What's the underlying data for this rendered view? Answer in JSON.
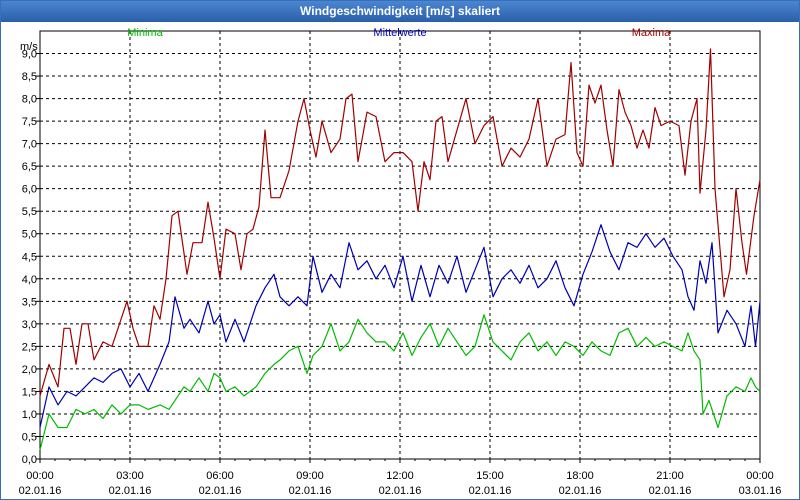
{
  "window": {
    "title": "Windgeschwindigkeit [m/s] skaliert"
  },
  "colors": {
    "title_bar": "#2f66b3",
    "grid": "#000000",
    "minima": "#00bb00",
    "mittel": "#0000b0",
    "maxima": "#a00000"
  },
  "chart_data": {
    "type": "line",
    "title": "Windgeschwindigkeit [m/s] skaliert",
    "ylabel": "m/s",
    "xlabel": "",
    "ylim": [
      0,
      9.5
    ],
    "y_ticks": [
      "0,0",
      "0,5",
      "1,0",
      "1,5",
      "2,0",
      "2,5",
      "3,0",
      "3,5",
      "4,0",
      "4,5",
      "5,0",
      "5,5",
      "6,0",
      "6,5",
      "7,0",
      "7,5",
      "8,0",
      "8,5",
      "9,0"
    ],
    "x_ticks": [
      {
        "time": "00:00",
        "date": "02.01.16"
      },
      {
        "time": "03:00",
        "date": "02.01.16"
      },
      {
        "time": "06:00",
        "date": "02.01.16"
      },
      {
        "time": "09:00",
        "date": "02.01.16"
      },
      {
        "time": "12:00",
        "date": "02.01.16"
      },
      {
        "time": "15:00",
        "date": "02.01.16"
      },
      {
        "time": "18:00",
        "date": "02.01.16"
      },
      {
        "time": "21:00",
        "date": "02.01.16"
      },
      {
        "time": "00:00",
        "date": "03.01.16"
      }
    ],
    "x_range_hours": [
      0,
      24
    ],
    "grid": true,
    "legend_position": "top",
    "series": [
      {
        "name": "Minima",
        "points": [
          [
            0,
            0.2
          ],
          [
            0.3,
            1.0
          ],
          [
            0.6,
            0.7
          ],
          [
            0.9,
            0.7
          ],
          [
            1.2,
            1.1
          ],
          [
            1.5,
            1.0
          ],
          [
            1.8,
            1.1
          ],
          [
            2.1,
            0.9
          ],
          [
            2.4,
            1.2
          ],
          [
            2.7,
            1.0
          ],
          [
            3.0,
            1.2
          ],
          [
            3.3,
            1.2
          ],
          [
            3.6,
            1.1
          ],
          [
            4.0,
            1.2
          ],
          [
            4.3,
            1.1
          ],
          [
            4.5,
            1.3
          ],
          [
            4.8,
            1.6
          ],
          [
            5.0,
            1.5
          ],
          [
            5.3,
            1.8
          ],
          [
            5.6,
            1.5
          ],
          [
            5.8,
            1.9
          ],
          [
            6.0,
            1.8
          ],
          [
            6.2,
            1.5
          ],
          [
            6.5,
            1.6
          ],
          [
            6.8,
            1.4
          ],
          [
            7.0,
            1.5
          ],
          [
            7.2,
            1.6
          ],
          [
            7.5,
            1.9
          ],
          [
            7.8,
            2.1
          ],
          [
            8.0,
            2.2
          ],
          [
            8.3,
            2.4
          ],
          [
            8.6,
            2.5
          ],
          [
            8.9,
            1.9
          ],
          [
            9.1,
            2.3
          ],
          [
            9.4,
            2.5
          ],
          [
            9.7,
            3.0
          ],
          [
            10.0,
            2.4
          ],
          [
            10.3,
            2.6
          ],
          [
            10.6,
            3.1
          ],
          [
            10.9,
            2.8
          ],
          [
            11.2,
            2.6
          ],
          [
            11.5,
            2.6
          ],
          [
            11.8,
            2.4
          ],
          [
            12.1,
            2.8
          ],
          [
            12.4,
            2.3
          ],
          [
            12.7,
            2.7
          ],
          [
            13.0,
            3.0
          ],
          [
            13.3,
            2.5
          ],
          [
            13.6,
            2.9
          ],
          [
            13.9,
            2.6
          ],
          [
            14.2,
            2.3
          ],
          [
            14.5,
            2.5
          ],
          [
            14.8,
            3.2
          ],
          [
            15.1,
            2.6
          ],
          [
            15.4,
            2.4
          ],
          [
            15.7,
            2.2
          ],
          [
            16.0,
            2.6
          ],
          [
            16.3,
            2.8
          ],
          [
            16.6,
            2.4
          ],
          [
            16.9,
            2.6
          ],
          [
            17.2,
            2.3
          ],
          [
            17.5,
            2.6
          ],
          [
            17.8,
            2.5
          ],
          [
            18.1,
            2.3
          ],
          [
            18.4,
            2.6
          ],
          [
            18.7,
            2.4
          ],
          [
            19.0,
            2.3
          ],
          [
            19.3,
            2.8
          ],
          [
            19.6,
            2.9
          ],
          [
            19.9,
            2.5
          ],
          [
            20.2,
            2.7
          ],
          [
            20.5,
            2.5
          ],
          [
            20.8,
            2.6
          ],
          [
            21.1,
            2.5
          ],
          [
            21.4,
            2.4
          ],
          [
            21.6,
            2.8
          ],
          [
            21.8,
            2.4
          ],
          [
            22.0,
            2.2
          ],
          [
            22.1,
            1.0
          ],
          [
            22.3,
            1.3
          ],
          [
            22.6,
            0.7
          ],
          [
            22.9,
            1.4
          ],
          [
            23.2,
            1.6
          ],
          [
            23.5,
            1.5
          ],
          [
            23.7,
            1.8
          ],
          [
            23.85,
            1.6
          ],
          [
            24.0,
            1.5
          ]
        ]
      },
      {
        "name": "Mittelwerte",
        "points": [
          [
            0,
            0.7
          ],
          [
            0.3,
            1.6
          ],
          [
            0.6,
            1.2
          ],
          [
            0.9,
            1.5
          ],
          [
            1.2,
            1.4
          ],
          [
            1.5,
            1.6
          ],
          [
            1.8,
            1.8
          ],
          [
            2.1,
            1.7
          ],
          [
            2.4,
            1.9
          ],
          [
            2.7,
            2.0
          ],
          [
            3.0,
            1.6
          ],
          [
            3.3,
            1.9
          ],
          [
            3.6,
            1.5
          ],
          [
            4.0,
            2.1
          ],
          [
            4.3,
            2.6
          ],
          [
            4.5,
            3.6
          ],
          [
            4.8,
            2.9
          ],
          [
            5.0,
            3.1
          ],
          [
            5.3,
            2.8
          ],
          [
            5.6,
            3.5
          ],
          [
            5.8,
            3.0
          ],
          [
            6.0,
            3.2
          ],
          [
            6.2,
            2.6
          ],
          [
            6.5,
            3.1
          ],
          [
            6.8,
            2.6
          ],
          [
            7.0,
            3.0
          ],
          [
            7.2,
            3.4
          ],
          [
            7.5,
            3.8
          ],
          [
            7.8,
            4.1
          ],
          [
            8.0,
            3.6
          ],
          [
            8.3,
            3.4
          ],
          [
            8.6,
            3.6
          ],
          [
            8.9,
            3.4
          ],
          [
            9.1,
            4.5
          ],
          [
            9.4,
            3.7
          ],
          [
            9.7,
            4.1
          ],
          [
            10.0,
            3.8
          ],
          [
            10.3,
            4.8
          ],
          [
            10.6,
            4.2
          ],
          [
            10.9,
            4.4
          ],
          [
            11.2,
            4.0
          ],
          [
            11.5,
            4.3
          ],
          [
            11.8,
            3.8
          ],
          [
            12.1,
            4.5
          ],
          [
            12.4,
            3.5
          ],
          [
            12.7,
            4.3
          ],
          [
            13.0,
            3.6
          ],
          [
            13.3,
            4.3
          ],
          [
            13.6,
            3.9
          ],
          [
            13.9,
            4.5
          ],
          [
            14.2,
            3.7
          ],
          [
            14.5,
            4.2
          ],
          [
            14.8,
            4.7
          ],
          [
            15.1,
            3.6
          ],
          [
            15.4,
            4.0
          ],
          [
            15.7,
            4.2
          ],
          [
            16.0,
            3.9
          ],
          [
            16.3,
            4.3
          ],
          [
            16.6,
            3.8
          ],
          [
            16.9,
            4.0
          ],
          [
            17.2,
            4.4
          ],
          [
            17.5,
            3.8
          ],
          [
            17.8,
            3.4
          ],
          [
            18.1,
            4.1
          ],
          [
            18.4,
            4.6
          ],
          [
            18.7,
            5.2
          ],
          [
            19.0,
            4.6
          ],
          [
            19.3,
            4.2
          ],
          [
            19.6,
            4.8
          ],
          [
            19.9,
            4.7
          ],
          [
            20.2,
            5.0
          ],
          [
            20.5,
            4.7
          ],
          [
            20.8,
            4.9
          ],
          [
            21.1,
            4.5
          ],
          [
            21.4,
            4.2
          ],
          [
            21.6,
            3.6
          ],
          [
            21.8,
            3.3
          ],
          [
            22.0,
            4.4
          ],
          [
            22.2,
            3.9
          ],
          [
            22.4,
            4.8
          ],
          [
            22.6,
            2.8
          ],
          [
            22.9,
            3.3
          ],
          [
            23.2,
            3.0
          ],
          [
            23.5,
            2.5
          ],
          [
            23.7,
            3.4
          ],
          [
            23.85,
            2.5
          ],
          [
            24.0,
            3.5
          ]
        ]
      },
      {
        "name": "Maxima",
        "points": [
          [
            0,
            1.4
          ],
          [
            0.3,
            2.1
          ],
          [
            0.6,
            1.6
          ],
          [
            0.8,
            2.9
          ],
          [
            1.0,
            2.9
          ],
          [
            1.2,
            2.1
          ],
          [
            1.4,
            3.0
          ],
          [
            1.6,
            3.0
          ],
          [
            1.8,
            2.2
          ],
          [
            2.1,
            2.6
          ],
          [
            2.4,
            2.5
          ],
          [
            2.7,
            3.1
          ],
          [
            2.9,
            3.5
          ],
          [
            3.1,
            2.9
          ],
          [
            3.3,
            2.5
          ],
          [
            3.6,
            2.5
          ],
          [
            3.8,
            3.4
          ],
          [
            4.0,
            3.1
          ],
          [
            4.2,
            4.0
          ],
          [
            4.4,
            5.4
          ],
          [
            4.6,
            5.5
          ],
          [
            4.9,
            4.1
          ],
          [
            5.1,
            4.8
          ],
          [
            5.4,
            4.8
          ],
          [
            5.6,
            5.7
          ],
          [
            5.8,
            4.9
          ],
          [
            6.0,
            4.0
          ],
          [
            6.2,
            5.1
          ],
          [
            6.5,
            5.0
          ],
          [
            6.7,
            4.2
          ],
          [
            6.9,
            5.0
          ],
          [
            7.1,
            5.1
          ],
          [
            7.3,
            5.6
          ],
          [
            7.5,
            7.3
          ],
          [
            7.7,
            5.8
          ],
          [
            8.0,
            5.8
          ],
          [
            8.3,
            6.4
          ],
          [
            8.6,
            7.5
          ],
          [
            8.8,
            8.0
          ],
          [
            9.0,
            7.3
          ],
          [
            9.2,
            6.7
          ],
          [
            9.4,
            7.5
          ],
          [
            9.7,
            6.8
          ],
          [
            10.0,
            7.1
          ],
          [
            10.2,
            8.0
          ],
          [
            10.4,
            8.1
          ],
          [
            10.6,
            6.6
          ],
          [
            10.9,
            7.7
          ],
          [
            11.2,
            7.6
          ],
          [
            11.5,
            6.6
          ],
          [
            11.8,
            6.8
          ],
          [
            12.1,
            6.8
          ],
          [
            12.4,
            6.6
          ],
          [
            12.6,
            5.5
          ],
          [
            12.8,
            6.6
          ],
          [
            13.0,
            6.2
          ],
          [
            13.2,
            7.5
          ],
          [
            13.4,
            7.6
          ],
          [
            13.6,
            6.6
          ],
          [
            13.9,
            7.3
          ],
          [
            14.2,
            8.0
          ],
          [
            14.5,
            7.0
          ],
          [
            14.8,
            7.4
          ],
          [
            15.1,
            7.6
          ],
          [
            15.4,
            6.5
          ],
          [
            15.7,
            6.9
          ],
          [
            16.0,
            6.7
          ],
          [
            16.3,
            7.1
          ],
          [
            16.6,
            8.0
          ],
          [
            16.9,
            6.5
          ],
          [
            17.2,
            7.1
          ],
          [
            17.5,
            7.2
          ],
          [
            17.7,
            8.8
          ],
          [
            17.9,
            6.8
          ],
          [
            18.1,
            6.5
          ],
          [
            18.3,
            8.3
          ],
          [
            18.5,
            7.9
          ],
          [
            18.7,
            8.3
          ],
          [
            18.9,
            7.3
          ],
          [
            19.1,
            6.5
          ],
          [
            19.3,
            8.2
          ],
          [
            19.5,
            7.7
          ],
          [
            19.7,
            7.4
          ],
          [
            19.9,
            6.9
          ],
          [
            20.1,
            7.3
          ],
          [
            20.3,
            6.9
          ],
          [
            20.5,
            7.8
          ],
          [
            20.7,
            7.4
          ],
          [
            21.0,
            7.5
          ],
          [
            21.3,
            7.4
          ],
          [
            21.5,
            6.3
          ],
          [
            21.7,
            7.5
          ],
          [
            21.9,
            8.0
          ],
          [
            22.0,
            5.9
          ],
          [
            22.2,
            7.3
          ],
          [
            22.35,
            9.1
          ],
          [
            22.5,
            6.0
          ],
          [
            22.8,
            3.6
          ],
          [
            23.0,
            4.2
          ],
          [
            23.2,
            6.0
          ],
          [
            23.4,
            4.8
          ],
          [
            23.55,
            4.1
          ],
          [
            23.8,
            5.4
          ],
          [
            24.0,
            6.2
          ]
        ]
      }
    ]
  }
}
